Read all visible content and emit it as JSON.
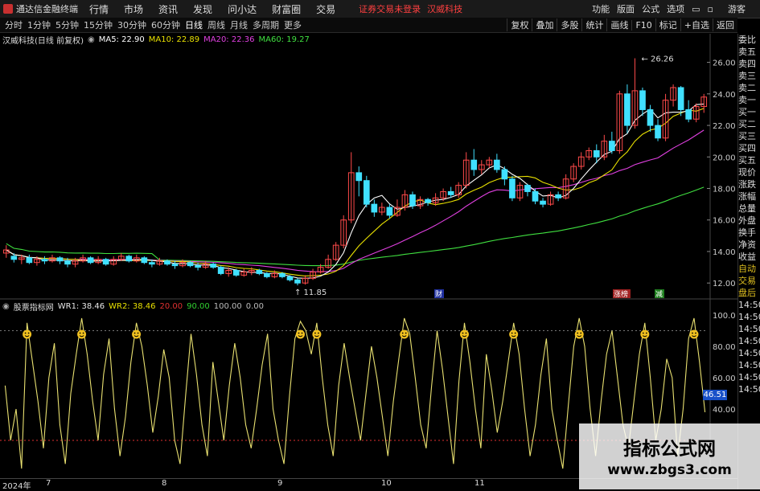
{
  "menubar": {
    "app_title": "通达信金融终端",
    "items": [
      "行情",
      "市场",
      "资讯",
      "发现",
      "问小达",
      "财富圈",
      "交易"
    ],
    "warning": "证券交易未登录",
    "stock_name": "汉威科技",
    "right_items": [
      "功能",
      "版面",
      "公式",
      "选项"
    ],
    "guest": "游客"
  },
  "toolbar": {
    "periods": [
      "分时",
      "1分钟",
      "5分钟",
      "15分钟",
      "30分钟",
      "60分钟",
      "日线",
      "周线",
      "月线",
      "多周期",
      "更多"
    ],
    "active_period": "日线",
    "right_items": [
      "复权",
      "叠加",
      "多股",
      "统计",
      "画线",
      "F10",
      "标记",
      "+自选",
      "返回"
    ]
  },
  "stock_header": {
    "title": "汉威科技(日线 前复权)",
    "ma5": "MA5: 22.90",
    "ma10": "MA10: 22.89",
    "ma20": "MA20: 22.36",
    "ma60": "MA60: 19.27"
  },
  "indicator_header": {
    "title": "股票指标网",
    "wr1": "WR1: 38.46",
    "wr2": "WR2: 38.46",
    "l20": "20.00",
    "l90": "90.00",
    "l100": "100.00",
    "l0": "0.00"
  },
  "price_axis": [
    "26.00",
    "24.00",
    "22.00",
    "20.00",
    "18.00",
    "16.00",
    "14.00",
    "12.00"
  ],
  "indicator_axis": [
    "100.0",
    "80.00",
    "60.00",
    "40.00"
  ],
  "annotations": {
    "high": "26.26",
    "low": "11.85"
  },
  "event_tags": [
    "财",
    "涨榜",
    "减"
  ],
  "side_panel": [
    "委比",
    "卖五",
    "卖四",
    "卖三",
    "卖二",
    "卖一",
    "买一",
    "买二",
    "买三",
    "买四",
    "买五",
    "现价",
    "涨跌",
    "涨幅",
    "总量",
    "外盘",
    "换手",
    "净资",
    "收益",
    "自动",
    "交易",
    "盘后",
    "14:50",
    "14:50",
    "14:50",
    "14:50",
    "14:50",
    "14:50",
    "14:50",
    "14:50"
  ],
  "float_value": "46.51",
  "date_axis": [
    "2024年",
    "7",
    "8",
    "9",
    "10",
    "11"
  ],
  "watermark": {
    "title": "指标公式网",
    "url": "www.zbgs3.com"
  },
  "colors": {
    "up": "#ff4a4a",
    "down": "#40e0ff",
    "ma5": "#ffffff",
    "ma10": "#e8e000",
    "ma20": "#e040e0",
    "ma60": "#40e040",
    "wr": "#e8e070"
  },
  "chart_data": {
    "type": "candlestick",
    "price_range": [
      11.5,
      27
    ],
    "candles": [
      [
        13.9,
        14.1,
        13.6,
        14.4
      ],
      [
        13.7,
        13.5,
        13.3,
        13.9
      ],
      [
        13.5,
        13.6,
        13.2,
        13.8
      ],
      [
        13.6,
        13.3,
        13.2,
        13.8
      ],
      [
        13.3,
        13.5,
        13.1,
        13.7
      ],
      [
        13.5,
        13.4,
        13.2,
        13.7
      ],
      [
        13.4,
        13.6,
        13.3,
        13.8
      ],
      [
        13.6,
        13.4,
        13.2,
        13.7
      ],
      [
        13.4,
        13.2,
        13.0,
        13.6
      ],
      [
        13.2,
        13.4,
        13.0,
        13.6
      ],
      [
        13.4,
        13.6,
        13.3,
        13.8
      ],
      [
        13.6,
        13.3,
        13.2,
        13.7
      ],
      [
        13.3,
        13.5,
        13.2,
        13.7
      ],
      [
        13.5,
        13.2,
        13.1,
        13.6
      ],
      [
        13.2,
        13.5,
        13.1,
        13.7
      ],
      [
        13.5,
        13.7,
        13.4,
        13.9
      ],
      [
        13.7,
        13.4,
        13.3,
        13.8
      ],
      [
        13.4,
        13.6,
        13.3,
        13.8
      ],
      [
        13.6,
        13.3,
        13.2,
        13.7
      ],
      [
        13.3,
        13.2,
        13.0,
        13.5
      ],
      [
        13.2,
        13.4,
        13.1,
        13.6
      ],
      [
        13.4,
        13.2,
        13.1,
        13.5
      ],
      [
        13.2,
        13.1,
        12.9,
        13.4
      ],
      [
        13.1,
        13.3,
        13.0,
        13.5
      ],
      [
        13.3,
        13.1,
        13.0,
        13.4
      ],
      [
        13.1,
        13.0,
        12.8,
        13.3
      ],
      [
        13.0,
        13.2,
        12.9,
        13.4
      ],
      [
        13.2,
        13.0,
        12.9,
        13.3
      ],
      [
        13.0,
        12.6,
        12.5,
        13.1
      ],
      [
        12.6,
        12.8,
        12.4,
        13.0
      ],
      [
        12.8,
        12.5,
        12.4,
        12.9
      ],
      [
        12.5,
        12.7,
        12.4,
        12.9
      ],
      [
        12.7,
        12.8,
        12.5,
        13.0
      ],
      [
        12.8,
        12.6,
        12.5,
        12.9
      ],
      [
        12.6,
        12.4,
        12.3,
        12.7
      ],
      [
        12.4,
        12.6,
        12.3,
        12.8
      ],
      [
        12.6,
        12.4,
        12.3,
        12.7
      ],
      [
        12.4,
        12.2,
        12.1,
        12.5
      ],
      [
        12.2,
        12.0,
        11.85,
        12.3
      ],
      [
        12.0,
        12.3,
        11.9,
        12.5
      ],
      [
        12.3,
        12.7,
        12.2,
        12.9
      ],
      [
        12.7,
        13.0,
        12.6,
        13.2
      ],
      [
        13.0,
        13.5,
        12.9,
        13.8
      ],
      [
        13.5,
        14.4,
        13.4,
        14.6
      ],
      [
        14.4,
        16.0,
        14.2,
        16.3
      ],
      [
        16.0,
        19.0,
        15.8,
        20.3
      ],
      [
        19.0,
        18.5,
        17.5,
        19.4
      ],
      [
        18.5,
        17.0,
        16.8,
        18.8
      ],
      [
        17.0,
        16.5,
        16.2,
        17.3
      ],
      [
        16.5,
        16.8,
        16.3,
        17.1
      ],
      [
        16.8,
        16.3,
        16.1,
        17.0
      ],
      [
        16.3,
        16.8,
        16.2,
        17.3
      ],
      [
        16.8,
        17.6,
        16.6,
        17.9
      ],
      [
        17.6,
        16.9,
        16.7,
        17.8
      ],
      [
        16.9,
        17.3,
        16.7,
        17.5
      ],
      [
        17.3,
        17.1,
        16.9,
        17.4
      ],
      [
        17.1,
        17.4,
        16.9,
        17.7
      ],
      [
        17.4,
        17.8,
        17.2,
        18.0
      ],
      [
        17.8,
        17.6,
        17.4,
        18.1
      ],
      [
        17.6,
        18.2,
        17.4,
        18.4
      ],
      [
        18.2,
        19.8,
        18.0,
        20.3
      ],
      [
        19.8,
        19.2,
        18.8,
        20.5
      ],
      [
        19.2,
        19.5,
        18.9,
        19.8
      ],
      [
        19.5,
        19.8,
        19.3,
        20.0
      ],
      [
        19.8,
        19.2,
        19.0,
        20.2
      ],
      [
        19.2,
        18.6,
        18.2,
        19.4
      ],
      [
        18.6,
        17.4,
        17.2,
        18.8
      ],
      [
        17.4,
        18.2,
        17.2,
        18.4
      ],
      [
        18.2,
        17.8,
        17.5,
        18.3
      ],
      [
        17.8,
        17.2,
        17.0,
        18.0
      ],
      [
        17.2,
        17.0,
        16.8,
        17.4
      ],
      [
        17.0,
        17.6,
        16.9,
        17.8
      ],
      [
        17.6,
        17.4,
        17.2,
        17.8
      ],
      [
        17.4,
        18.6,
        17.3,
        18.9
      ],
      [
        18.6,
        19.4,
        18.4,
        19.6
      ],
      [
        19.4,
        20.0,
        19.2,
        20.3
      ],
      [
        20.0,
        20.4,
        19.8,
        20.6
      ],
      [
        20.4,
        20.0,
        19.6,
        20.8
      ],
      [
        20.0,
        21.0,
        19.8,
        21.4
      ],
      [
        21.0,
        20.4,
        20.2,
        21.6
      ],
      [
        20.4,
        24.0,
        20.2,
        24.2
      ],
      [
        24.0,
        22.0,
        21.5,
        24.6
      ],
      [
        22.0,
        24.2,
        21.8,
        26.26
      ],
      [
        24.2,
        23.0,
        22.6,
        24.4
      ],
      [
        23.0,
        22.0,
        21.6,
        23.3
      ],
      [
        22.0,
        21.2,
        21.0,
        22.4
      ],
      [
        21.2,
        23.6,
        21.0,
        24.0
      ],
      [
        23.6,
        24.4,
        23.2,
        24.6
      ],
      [
        24.4,
        23.0,
        22.6,
        24.5
      ],
      [
        23.0,
        22.4,
        22.2,
        23.6
      ],
      [
        22.4,
        23.2,
        22.2,
        23.4
      ],
      [
        23.2,
        23.8,
        22.8,
        24.0
      ]
    ],
    "wr_values": [
      55,
      20,
      40,
      2,
      95,
      70,
      45,
      15,
      60,
      82,
      30,
      5,
      50,
      75,
      98,
      75,
      45,
      20,
      62,
      85,
      40,
      10,
      35,
      70,
      95,
      80,
      55,
      25,
      48,
      78,
      60,
      20,
      5,
      48,
      88,
      62,
      30,
      10,
      70,
      45,
      20,
      55,
      82,
      60,
      30,
      15,
      40,
      68,
      88,
      40,
      20,
      5,
      48,
      85,
      96,
      90,
      75,
      95,
      60,
      30,
      10,
      55,
      82,
      60,
      40,
      20,
      50,
      80,
      60,
      35,
      10,
      45,
      72,
      98,
      88,
      60,
      30,
      15,
      55,
      90,
      65,
      35,
      5,
      58,
      95,
      70,
      40,
      15,
      75,
      52,
      25,
      45,
      70,
      95,
      75,
      40,
      10,
      30,
      62,
      85,
      40,
      20,
      2,
      42,
      80,
      98,
      80,
      40,
      10,
      45,
      75,
      90,
      60,
      30,
      15,
      45,
      75,
      95,
      60,
      20,
      40,
      72,
      60,
      10,
      40,
      85,
      98,
      70,
      38
    ]
  }
}
